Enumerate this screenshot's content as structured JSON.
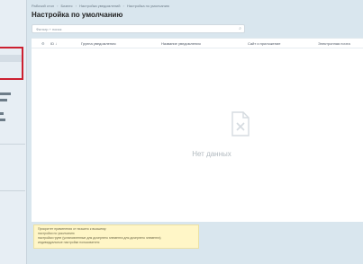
{
  "breadcrumbs": [
    "Рабочий стол",
    "Бизнес",
    "Настройка уведомлений",
    "Настройка по умолчанию"
  ],
  "page": {
    "title": "Настройка по умолчанию"
  },
  "search": {
    "placeholder": "Фильтр + поиск"
  },
  "grid": {
    "columns": [
      "ID",
      "Группа уведомления",
      "Название уведомления",
      "Сайт и приложение",
      "Электронная почта"
    ],
    "empty_text": "Нет данных"
  },
  "notice": {
    "lines": [
      "Приоритет применения от низшего к высшему:",
      "настройки по умолчанию",
      "настройки групп (установленные для дочернего элемента для дочернего элемента)",
      "индивидуальные настройки пользователя"
    ]
  },
  "colors": {
    "highlight": "#cc2030",
    "notice_bg": "#fff6c7",
    "background": "#d9e6ee"
  }
}
